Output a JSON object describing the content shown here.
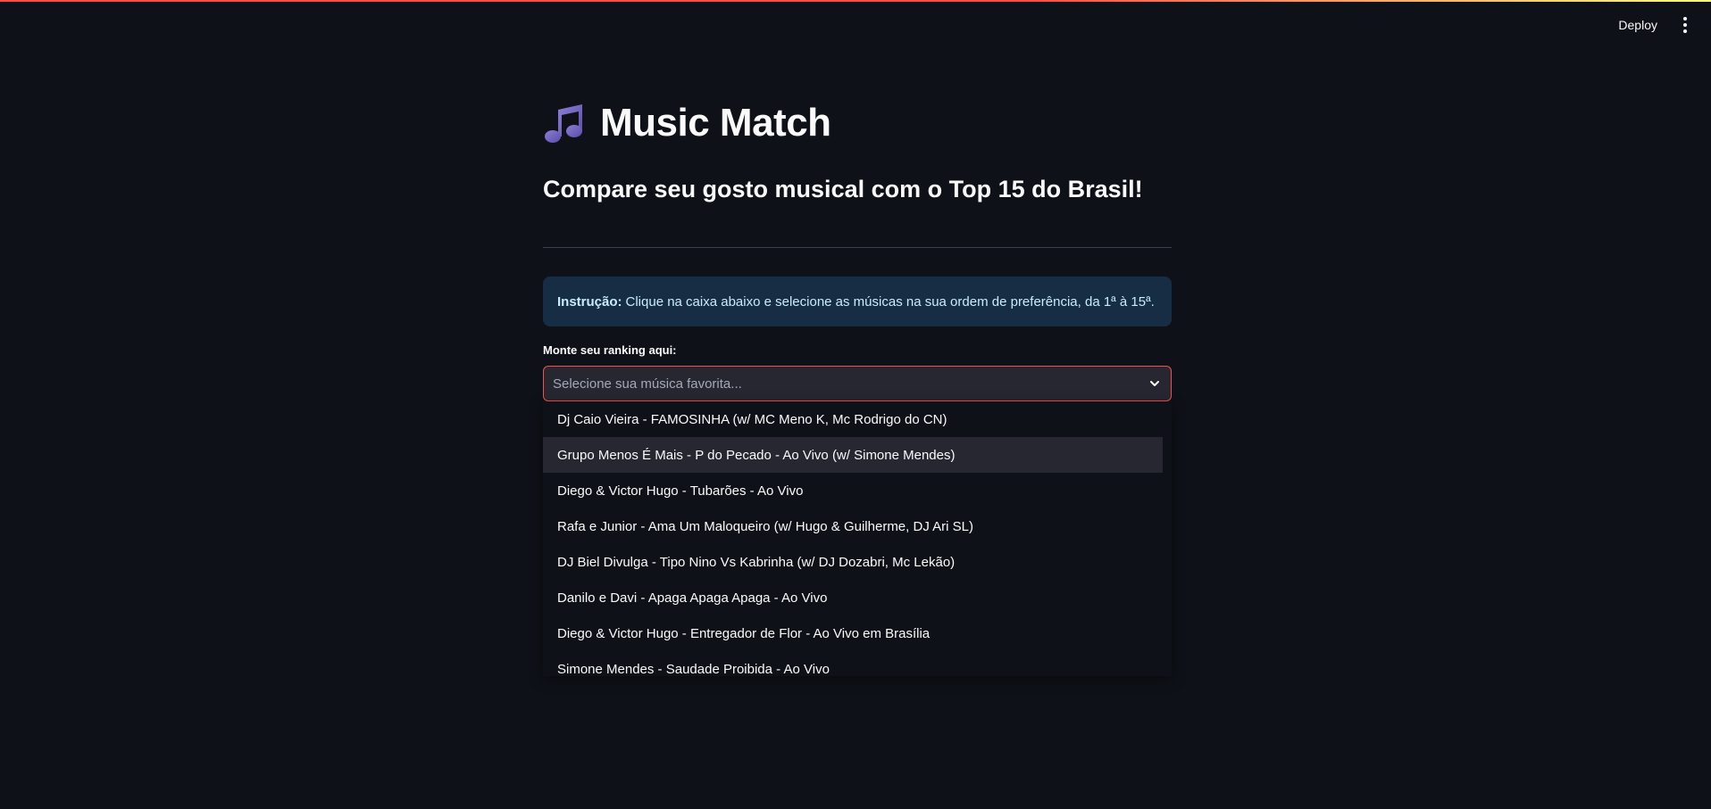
{
  "header": {
    "deploy_label": "Deploy",
    "menu_icon": "vertical-dots-icon"
  },
  "app": {
    "icon": "musical-notes-icon",
    "title": "Music Match",
    "subtitle": "Compare seu gosto musical com o Top 15 do Brasil!"
  },
  "info": {
    "label": "Instrução:",
    "text": "Clique na caixa abaixo e selecione as músicas na sua ordem de preferência, da 1ª à 15ª."
  },
  "ranking": {
    "label": "Monte seu ranking aqui:",
    "placeholder": "Selecione sua música favorita...",
    "options": [
      "Dj Caio Vieira - FAMOSINHA (w/ MC Meno K, Mc Rodrigo do CN)",
      "Grupo Menos É Mais - P do Pecado - Ao Vivo (w/ Simone Mendes)",
      "Diego & Victor Hugo - Tubarões - Ao Vivo",
      "Rafa e Junior - Ama Um Maloqueiro (w/ Hugo & Guilherme, DJ Ari SL)",
      "DJ Biel Divulga - Tipo Nino Vs Kabrinha (w/ DJ Dozabri, Mc Lekão)",
      "Danilo e Davi - Apaga Apaga Apaga - Ao Vivo",
      "Diego & Victor Hugo - Entregador de Flor - Ao Vivo em Brasília",
      "Simone Mendes - Saudade Proibida - Ao Vivo"
    ]
  },
  "colors": {
    "background": "#0e1117",
    "accent": "#ff4b4b",
    "info_bg": "#172d43",
    "info_text": "#c7ebff",
    "input_bg": "#262730"
  }
}
